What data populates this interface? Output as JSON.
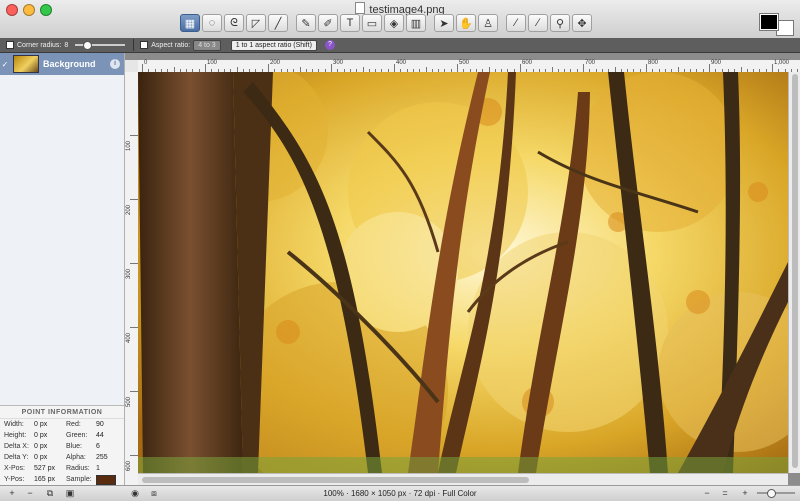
{
  "window": {
    "title": "testimage4.png"
  },
  "toolbar": {
    "tools": [
      {
        "name": "rect-select-tool",
        "icon": "▦",
        "active": true
      },
      {
        "name": "ellipse-select-tool",
        "icon": "◌"
      },
      {
        "name": "lasso-tool",
        "icon": "ᘓ"
      },
      {
        "name": "polygon-lasso-tool",
        "icon": "◸"
      },
      {
        "name": "magic-wand-tool",
        "icon": "╱"
      },
      {
        "name": "pencil-tool",
        "icon": "✎",
        "gap": true
      },
      {
        "name": "brush-tool",
        "icon": "✐"
      },
      {
        "name": "text-tool",
        "icon": "T"
      },
      {
        "name": "eraser-tool",
        "icon": "▭"
      },
      {
        "name": "paint-bucket-tool",
        "icon": "◈"
      },
      {
        "name": "gradient-tool",
        "icon": "▥"
      },
      {
        "name": "move-tool",
        "icon": "➤",
        "gap": true
      },
      {
        "name": "hand-tool",
        "icon": "✋"
      },
      {
        "name": "clone-stamp-tool",
        "icon": "♙"
      },
      {
        "name": "eyedropper-tool",
        "icon": "⁄",
        "gap": true
      },
      {
        "name": "smudge-tool",
        "icon": "∕"
      },
      {
        "name": "zoom-tool",
        "icon": "⚲"
      },
      {
        "name": "pan-tool",
        "icon": "✥"
      }
    ]
  },
  "colors": {
    "foreground": "#000000",
    "background": "#ffffff"
  },
  "options": {
    "corner_radius_label": "Corner radius:",
    "corner_radius_value": "8",
    "aspect_ratio_label": "Aspect ratio:",
    "aspect_ratio_value": "4 to 3",
    "aspect_mode": "1 to 1 aspect ratio (Shift)",
    "help": "?"
  },
  "layers": [
    {
      "name": "Background",
      "visible_icon": "✓",
      "info_icon": "i"
    }
  ],
  "point_info": {
    "title": "POINT INFORMATION",
    "rows": [
      {
        "k1": "Width:",
        "v1": "0 px",
        "k2": "Red:",
        "v2": "90"
      },
      {
        "k1": "Height:",
        "v1": "0 px",
        "k2": "Green:",
        "v2": "44"
      },
      {
        "k1": "Delta X:",
        "v1": "0 px",
        "k2": "Blue:",
        "v2": "6"
      },
      {
        "k1": "Delta Y:",
        "v1": "0 px",
        "k2": "Alpha:",
        "v2": "255"
      },
      {
        "k1": "X-Pos:",
        "v1": "527 px",
        "k2": "Radius:",
        "v2": "1"
      },
      {
        "k1": "Y-Pos:",
        "v1": "165 px",
        "k2": "Sample:",
        "v2": ""
      }
    ],
    "sample_color": "#5a2c0f"
  },
  "rulers": {
    "h_labels": [
      "0",
      "100",
      "200",
      "300",
      "400",
      "500",
      "600",
      "700",
      "800",
      "900",
      "1,000"
    ],
    "v_labels": [
      "100",
      "200",
      "300",
      "400",
      "500",
      "600"
    ]
  },
  "status": {
    "text": "100% · 1680 × 1050 px · 72 dpi · Full Color",
    "minus": "−",
    "plus": "+",
    "equals": "="
  }
}
